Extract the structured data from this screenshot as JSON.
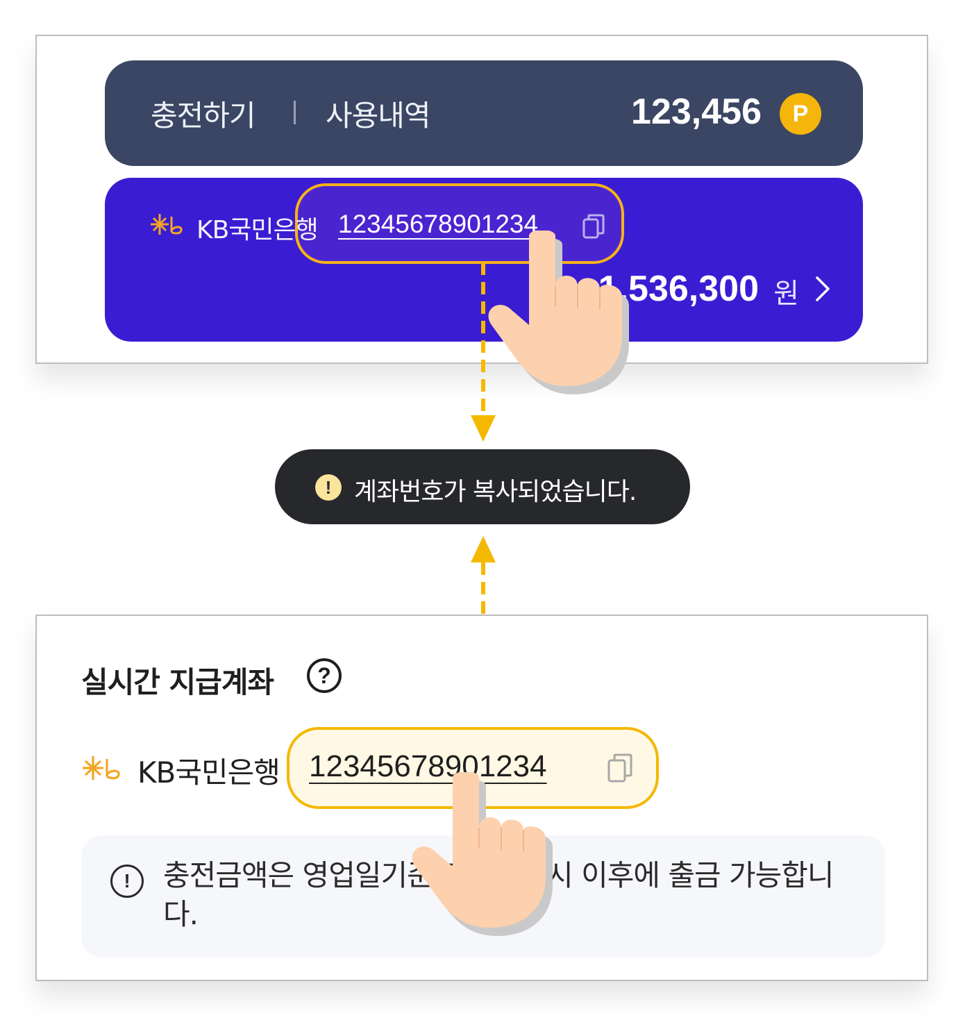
{
  "top_card": {
    "charge_label": "충전하기",
    "history_label": "사용내역",
    "points": "123,456",
    "points_badge": "P",
    "bank_name": "KB국민은행",
    "account_number": "12345678901234",
    "balance": "1,536,300",
    "currency": "원"
  },
  "toast": {
    "icon": "!",
    "message": "계좌번호가 복사되었습니다."
  },
  "bottom_panel": {
    "title": "실시간 지급계좌",
    "help_icon": "?",
    "bank_name": "KB국민은행",
    "account_number": "12345678901234",
    "notice_icon": "!",
    "notice": "충전금액은 영업일기준 다음날 0시 이후에 출금 가능합니다."
  },
  "colors": {
    "points_bar": "#3a4663",
    "account_card": "#3a1dd2",
    "highlight": "#f5b800",
    "toast_bg": "#27282c",
    "hand": "#fdd1ad"
  },
  "icons": [
    "p-badge-icon",
    "kb-logo-icon",
    "copy-icon",
    "chevron-right-icon",
    "alert-icon",
    "help-icon",
    "pointer-hand-icon"
  ]
}
